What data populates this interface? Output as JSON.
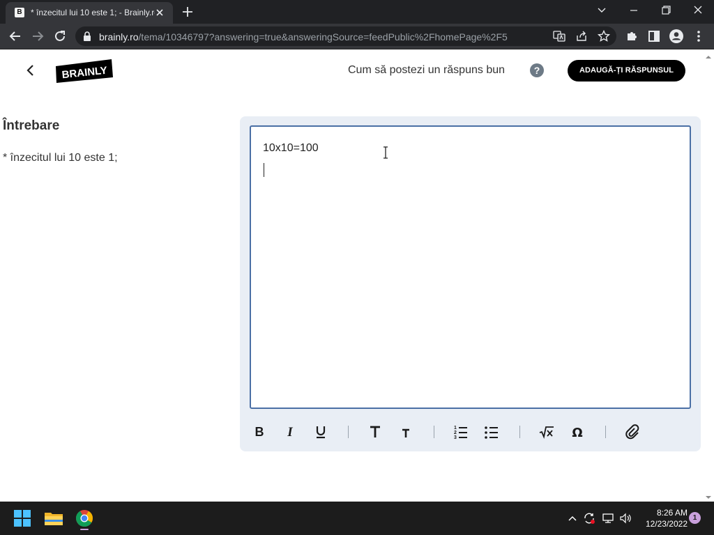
{
  "browser": {
    "tab_title": "* înzecitul lui 10 este 1; - Brainly.ro",
    "url_host": "brainly.ro",
    "url_path": "/tema/10346797?answering=true&answeringSource=feedPublic%2FhomePage%2F5"
  },
  "header": {
    "logo_text": "BRAINLY",
    "howto_link": "Cum să postezi un răspuns bun",
    "help_symbol": "?",
    "add_answer_button": "ADAUGĂ-ȚI RĂSPUNSUL"
  },
  "question": {
    "heading": "Întrebare",
    "text": "* înzecitul lui 10 este 1;"
  },
  "editor": {
    "line1": "10x10=100",
    "toolbar_icons": [
      "bold-icon",
      "italic-icon",
      "underline-icon",
      "heading-icon",
      "subheading-icon",
      "ordered-list-icon",
      "unordered-list-icon",
      "square-root-icon",
      "omega-icon",
      "attachment-icon"
    ]
  },
  "taskbar": {
    "time": "8:26 AM",
    "date": "12/23/2022",
    "notification_count": "1"
  },
  "colors": {
    "brand_black": "#000000",
    "editor_border": "#4a6fa5",
    "editor_panel": "#e9eef5"
  }
}
